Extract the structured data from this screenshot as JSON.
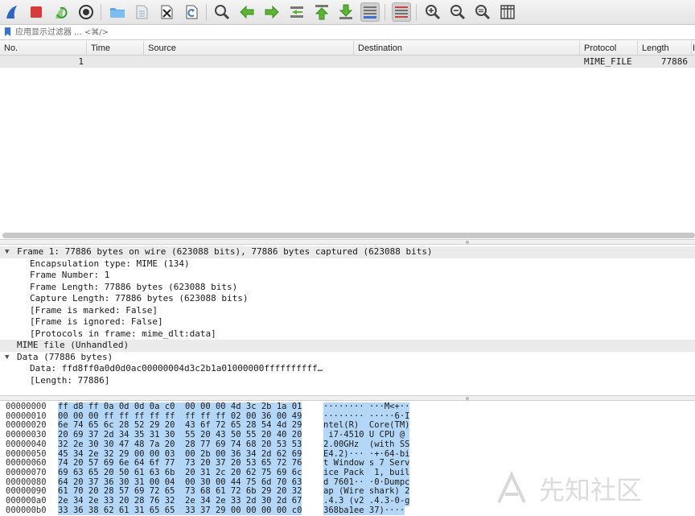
{
  "toolbar": {
    "items": [
      {
        "name": "start-capture-icon",
        "color": "#3a6fd0"
      },
      {
        "name": "stop-capture-icon",
        "color": "#d63b3b"
      },
      {
        "name": "restart-capture-icon",
        "color": "#4caf50"
      },
      {
        "name": "capture-options-icon",
        "color": "#444444"
      },
      {
        "name": "open-file-icon",
        "color": "#5aa0e0"
      },
      {
        "name": "save-file-icon",
        "color": "#9aa4ad"
      },
      {
        "name": "close-file-icon",
        "color": "#555555"
      },
      {
        "name": "reload-file-icon",
        "color": "#4a86c5"
      },
      {
        "name": "find-packet-icon",
        "color": "#555555"
      },
      {
        "name": "go-back-icon",
        "color": "#5cb531"
      },
      {
        "name": "go-forward-icon",
        "color": "#5cb531"
      },
      {
        "name": "go-to-packet-icon",
        "color": "#5cb531"
      },
      {
        "name": "first-packet-icon",
        "color": "#5cb531"
      },
      {
        "name": "last-packet-icon",
        "color": "#5cb531"
      },
      {
        "name": "auto-scroll-icon",
        "color": "#3a6fd0"
      },
      {
        "name": "colorize-icon",
        "color": "#d04040"
      },
      {
        "name": "zoom-in-icon",
        "color": "#555555"
      },
      {
        "name": "zoom-out-icon",
        "color": "#555555"
      },
      {
        "name": "normal-size-icon",
        "color": "#555555"
      },
      {
        "name": "resize-columns-icon",
        "color": "#555555"
      }
    ]
  },
  "filter": {
    "placeholder": "应用显示过滤器 ... <⌘/>",
    "value": ""
  },
  "packet_list": {
    "columns": [
      "No.",
      "Time",
      "Source",
      "Destination",
      "Protocol",
      "Length",
      "I"
    ],
    "rows": [
      {
        "no": "1",
        "time": "",
        "source": "",
        "destination": "",
        "protocol": "MIME_FILE",
        "length": "77886",
        "info": ""
      }
    ]
  },
  "details": {
    "frame_header": "Frame 1: 77886 bytes on wire (623088 bits), 77886 bytes captured (623088 bits)",
    "frame_children": [
      "Encapsulation type: MIME (134)",
      "Frame Number: 1",
      "Frame Length: 77886 bytes (623088 bits)",
      "Capture Length: 77886 bytes (623088 bits)",
      "[Frame is marked: False]",
      "[Frame is ignored: False]",
      "[Protocols in frame: mime_dlt:data]"
    ],
    "mime_header": "MIME file (Unhandled)",
    "data_header": "Data (77886 bytes)",
    "data_children": [
      "Data: ffd8ff0a0d0d0ac00000004d3c2b1a01000000ffffffffff…",
      "[Length: 77886]"
    ]
  },
  "hex": {
    "rows": [
      {
        "offset": "00000000",
        "bytes": "ff d8 ff 0a 0d 0d 0a c0  00 00 00 4d 3c 2b 1a 01",
        "ascii": "········ ···M<+··"
      },
      {
        "offset": "00000010",
        "bytes": "00 00 00 ff ff ff ff ff  ff ff ff 02 00 36 00 49",
        "ascii": "········ ·····6·I"
      },
      {
        "offset": "00000020",
        "bytes": "6e 74 65 6c 28 52 29 20  43 6f 72 65 28 54 4d 29",
        "ascii": "ntel(R)  Core(TM)"
      },
      {
        "offset": "00000030",
        "bytes": "20 69 37 2d 34 35 31 30  55 20 43 50 55 20 40 20",
        "ascii": " i7-4510 U CPU @ "
      },
      {
        "offset": "00000040",
        "bytes": "32 2e 30 30 47 48 7a 20  28 77 69 74 68 20 53 53",
        "ascii": "2.00GHz  (with SS"
      },
      {
        "offset": "00000050",
        "bytes": "45 34 2e 32 29 00 00 03  00 2b 00 36 34 2d 62 69",
        "ascii": "E4.2)··· ·+·64-bi"
      },
      {
        "offset": "00000060",
        "bytes": "74 20 57 69 6e 64 6f 77  73 20 37 20 53 65 72 76",
        "ascii": "t Window s 7 Serv"
      },
      {
        "offset": "00000070",
        "bytes": "69 63 65 20 50 61 63 6b  20 31 2c 20 62 75 69 6c",
        "ascii": "ice Pack  1, buil"
      },
      {
        "offset": "00000080",
        "bytes": "64 20 37 36 30 31 00 04  00 30 00 44 75 6d 70 63",
        "ascii": "d 7601·· ·0·Dumpc"
      },
      {
        "offset": "00000090",
        "bytes": "61 70 20 28 57 69 72 65  73 68 61 72 6b 29 20 32",
        "ascii": "ap (Wire shark) 2"
      },
      {
        "offset": "000000a0",
        "bytes": "2e 34 2e 33 20 28 76 32  2e 34 2e 33 2d 30 2d 67",
        "ascii": ".4.3 (v2 .4.3-0-g"
      },
      {
        "offset": "000000b0",
        "bytes": "33 36 38 62 61 31 65 65  33 37 29 00 00 00 00 c0",
        "ascii": "368ba1ee 37)····"
      }
    ]
  },
  "watermark": {
    "text": "先知社区"
  }
}
